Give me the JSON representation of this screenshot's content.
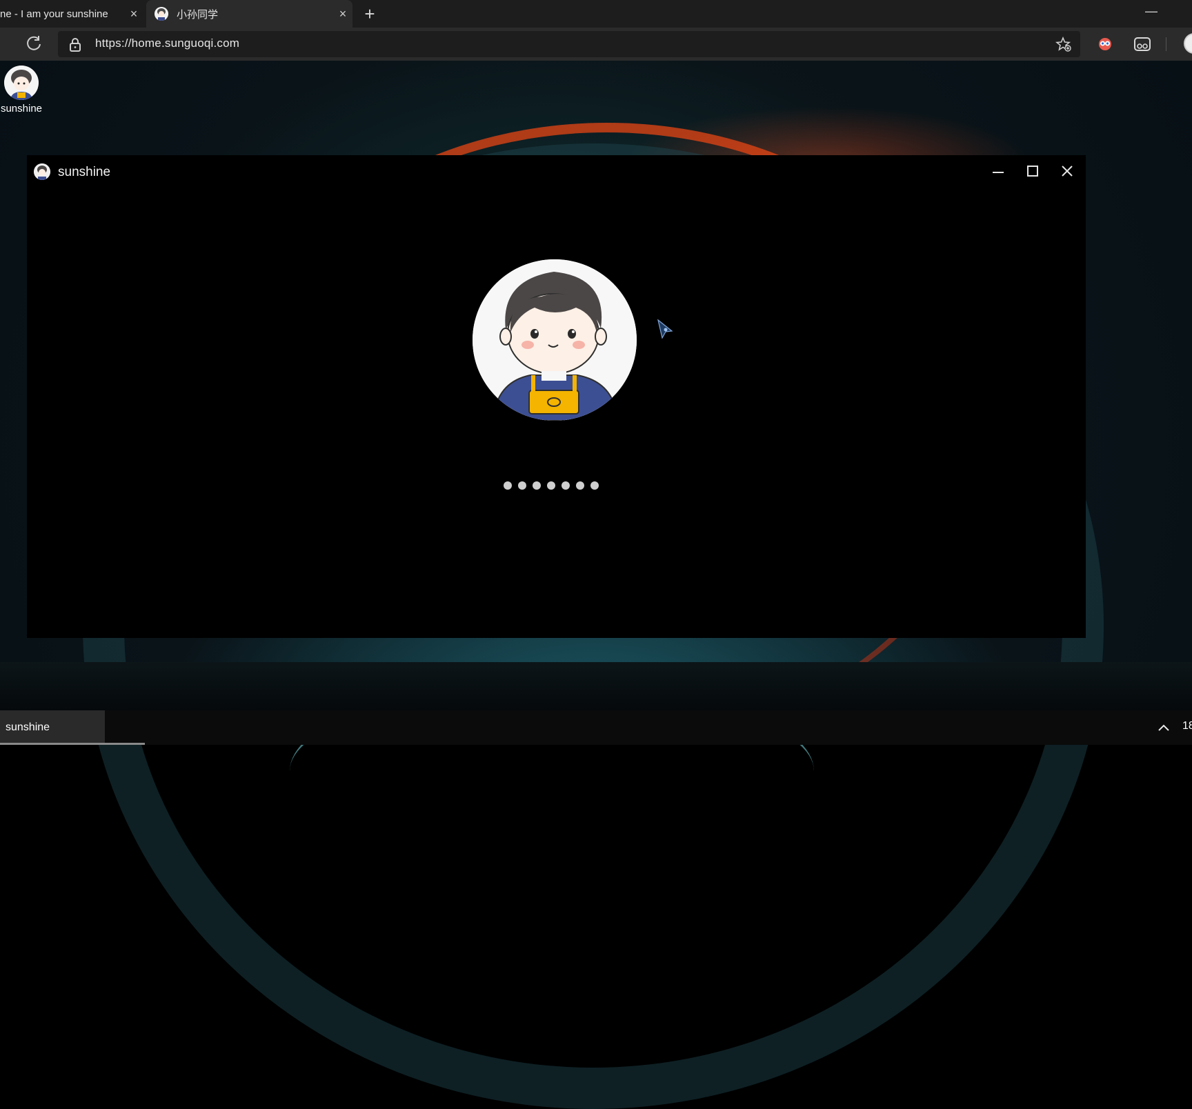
{
  "browser": {
    "tabs": [
      {
        "title": "ne - I am your sunshine",
        "active": false
      },
      {
        "title": "小孙同学",
        "active": true
      }
    ],
    "url": "https://home.sunguoqi.com"
  },
  "desktop": {
    "icon_label": "sunshine"
  },
  "app_window": {
    "title": "sunshine",
    "loading_dots": 7
  },
  "taskbar": {
    "item_label": "sunshine",
    "clock_partial": "18"
  },
  "colors": {
    "accent_red": "#e6461e",
    "accent_cyan": "#78dce6",
    "window_bg": "#000000"
  }
}
